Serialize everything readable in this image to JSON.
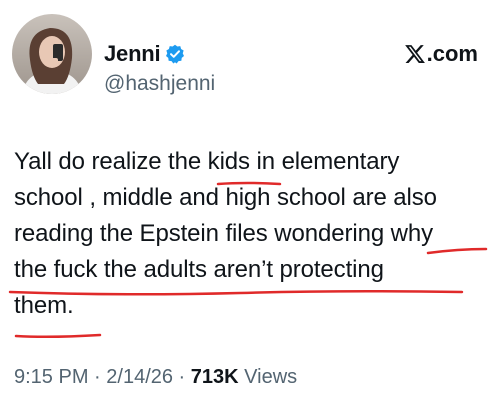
{
  "author": {
    "display_name": "Jenni",
    "handle": "@hashjenni",
    "verified_color": "#1d9bf0",
    "avatar": "profile-photo"
  },
  "brand": {
    "label": ".com",
    "logo": "x-logo-icon"
  },
  "tweet": {
    "lines": [
      "Yall do realize the kids in elementary",
      "school , middle and high school are also",
      "reading the Epstein files wondering why",
      "the fuck the adults aren’t protecting",
      "them."
    ],
    "annotation_color": "#e02a2a"
  },
  "meta": {
    "time": "9:15 PM",
    "separator": " · ",
    "date": "2/14/26",
    "views_count": "713K",
    "views_label": " Views"
  }
}
